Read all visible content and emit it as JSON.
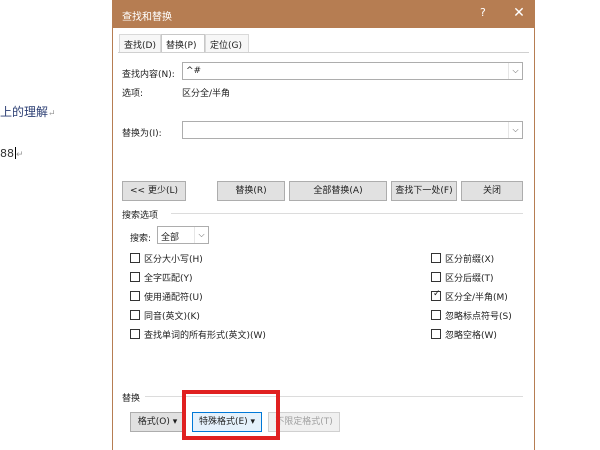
{
  "document": {
    "line1": "上的理解",
    "line1_mark": "↵",
    "line2": "88",
    "line2_mark": "↵"
  },
  "dialog": {
    "title": "查找和替换",
    "help_label": "?",
    "close_label": "✕",
    "tabs": [
      {
        "label": "查找(D)",
        "active": false
      },
      {
        "label": "替换(P)",
        "active": true
      },
      {
        "label": "定位(G)",
        "active": false
      }
    ],
    "find": {
      "label": "查找内容(N):",
      "value": "^#",
      "options_label": "选项:",
      "options_value": "区分全/半角"
    },
    "replace": {
      "label": "替换为(I):",
      "value": ""
    },
    "buttons": {
      "less": "<< 更少(L)",
      "replace": "替换(R)",
      "replace_all": "全部替换(A)",
      "find_next": "查找下一处(F)",
      "close": "关闭"
    },
    "search_options": {
      "group_label": "搜索选项",
      "search_label": "搜索:",
      "search_value": "全部",
      "left_checks": [
        {
          "label": "区分大小写(H)",
          "checked": false
        },
        {
          "label": "全字匹配(Y)",
          "checked": false
        },
        {
          "label": "使用通配符(U)",
          "checked": false
        },
        {
          "label": "同音(英文)(K)",
          "checked": false
        },
        {
          "label": "查找单词的所有形式(英文)(W)",
          "checked": false
        }
      ],
      "right_checks": [
        {
          "label": "区分前缀(X)",
          "checked": false
        },
        {
          "label": "区分后缀(T)",
          "checked": false
        },
        {
          "label": "区分全/半角(M)",
          "checked": true
        },
        {
          "label": "忽略标点符号(S)",
          "checked": false
        },
        {
          "label": "忽略空格(W)",
          "checked": false
        }
      ]
    },
    "replace_section": {
      "group_label": "替换",
      "format_button": "格式(O) ▾",
      "special_button": "特殊格式(E) ▾",
      "no_format_button": "不限定格式(T)"
    },
    "colors": {
      "titlebar": "#b67d52",
      "highlight": "#e02020"
    }
  }
}
